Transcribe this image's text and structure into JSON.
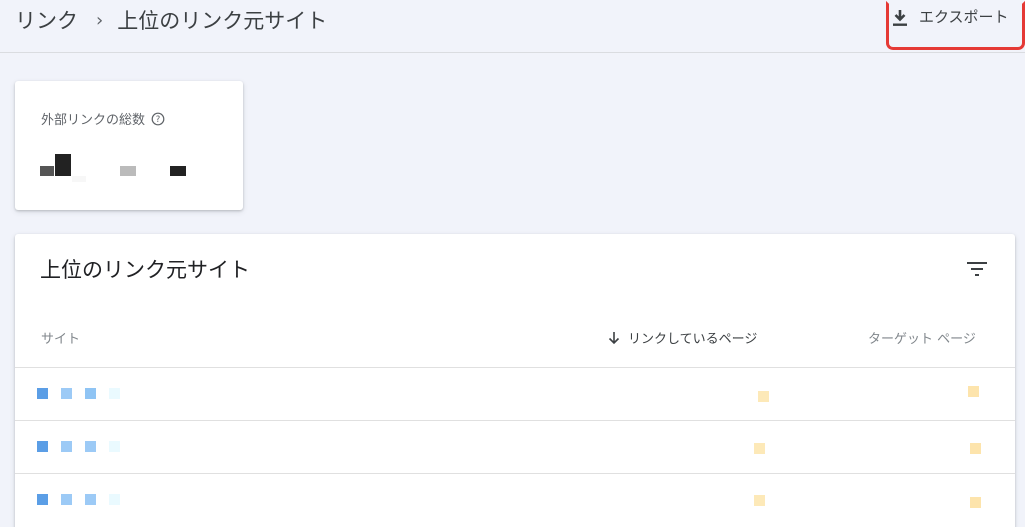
{
  "header": {
    "breadcrumb_root": "リンク",
    "breadcrumb_sep": "›",
    "breadcrumb_current": "上位のリンク元サイト",
    "export_label": "エクスポート",
    "export_icon": "download-icon"
  },
  "summary": {
    "label": "外部リンクの総数",
    "help_icon": "help-circle-icon"
  },
  "table": {
    "title": "上位のリンク元サイト",
    "filter_icon": "filter-icon",
    "columns": {
      "site": "サイト",
      "linking_pages": "リンクしているページ",
      "target_pages": "ターゲット ページ"
    },
    "sort_icon": "arrow-down-icon",
    "rows": [
      {
        "site": "",
        "linking_pages": "",
        "target_pages": ""
      },
      {
        "site": "",
        "linking_pages": "",
        "target_pages": ""
      },
      {
        "site": "",
        "linking_pages": "",
        "target_pages": ""
      }
    ]
  },
  "colors": {
    "background": "#f1f3fa",
    "card": "#ffffff",
    "highlight_outline": "#e53935",
    "redacted_link_dark": "#5b9ee6",
    "redacted_link_light": "#9ccaf6",
    "redacted_number": "#fde9b8"
  }
}
